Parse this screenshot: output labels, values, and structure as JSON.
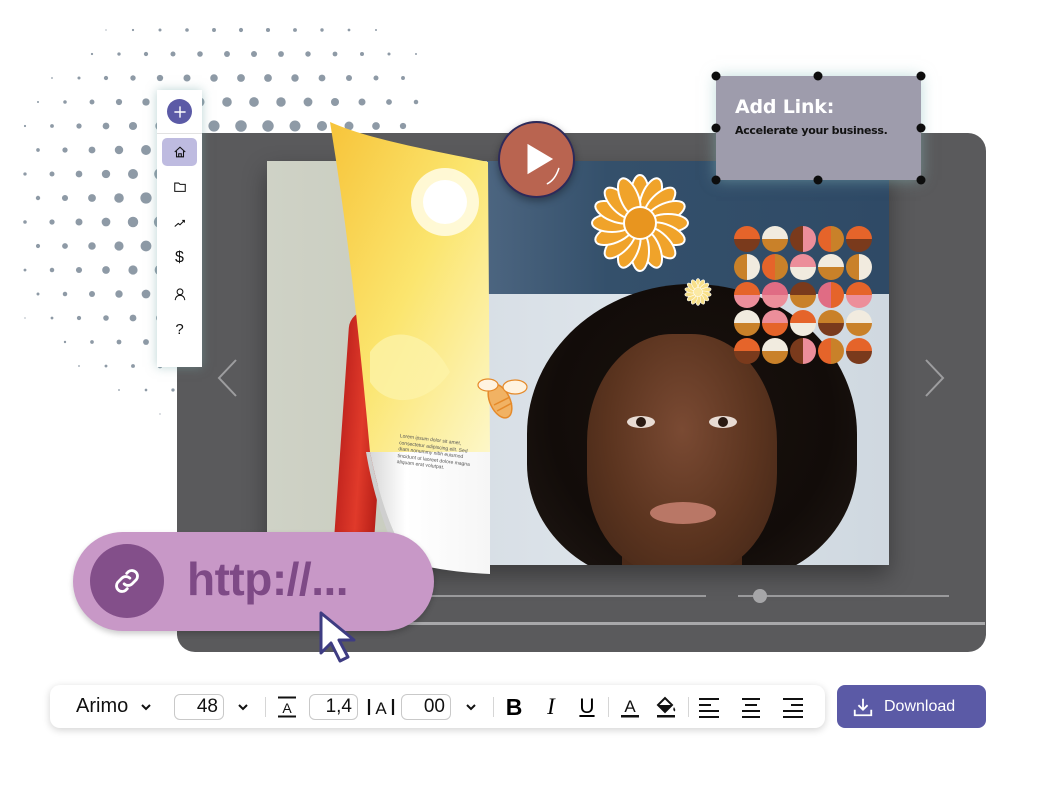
{
  "sidebar": {
    "add_button": "add",
    "items": [
      {
        "icon": "home-icon",
        "label": "Home",
        "active": true
      },
      {
        "icon": "folder-icon",
        "label": "Files",
        "active": false
      },
      {
        "icon": "trend-icon",
        "label": "Analytics",
        "active": false
      },
      {
        "icon": "dollar-icon",
        "label": "$",
        "active": false
      },
      {
        "icon": "user-icon",
        "label": "Account",
        "active": false
      },
      {
        "icon": "help-icon",
        "label": "?",
        "active": false
      }
    ]
  },
  "link_card": {
    "title": "Add Link:",
    "subtitle": "Accelerate your business."
  },
  "url_pill": {
    "text": "http://..."
  },
  "page_text": "Lorem ipsum dolor sit amet, consectetur adipiscing elit. Sed diam nonummy nibh euismod tincidunt ut laoreet dolore magna aliquam erat volutpat.",
  "player": {
    "scrubber_position": 0.05,
    "progress": 1.0
  },
  "toolbar": {
    "font_family": "Arimo",
    "font_size": "48",
    "line_height": "1,4",
    "letter_spacing": "00",
    "bold": "B",
    "italic": "I",
    "underline": "U"
  },
  "download_button": {
    "label": "Download"
  },
  "colors": {
    "accent": "#5b5aa6",
    "player_bg": "#5a5a5c",
    "link_card_bg": "#9e9cac",
    "url_pill_bg": "#c898c7",
    "url_pill_dark": "#834f8a",
    "play_button": "#b96450"
  }
}
